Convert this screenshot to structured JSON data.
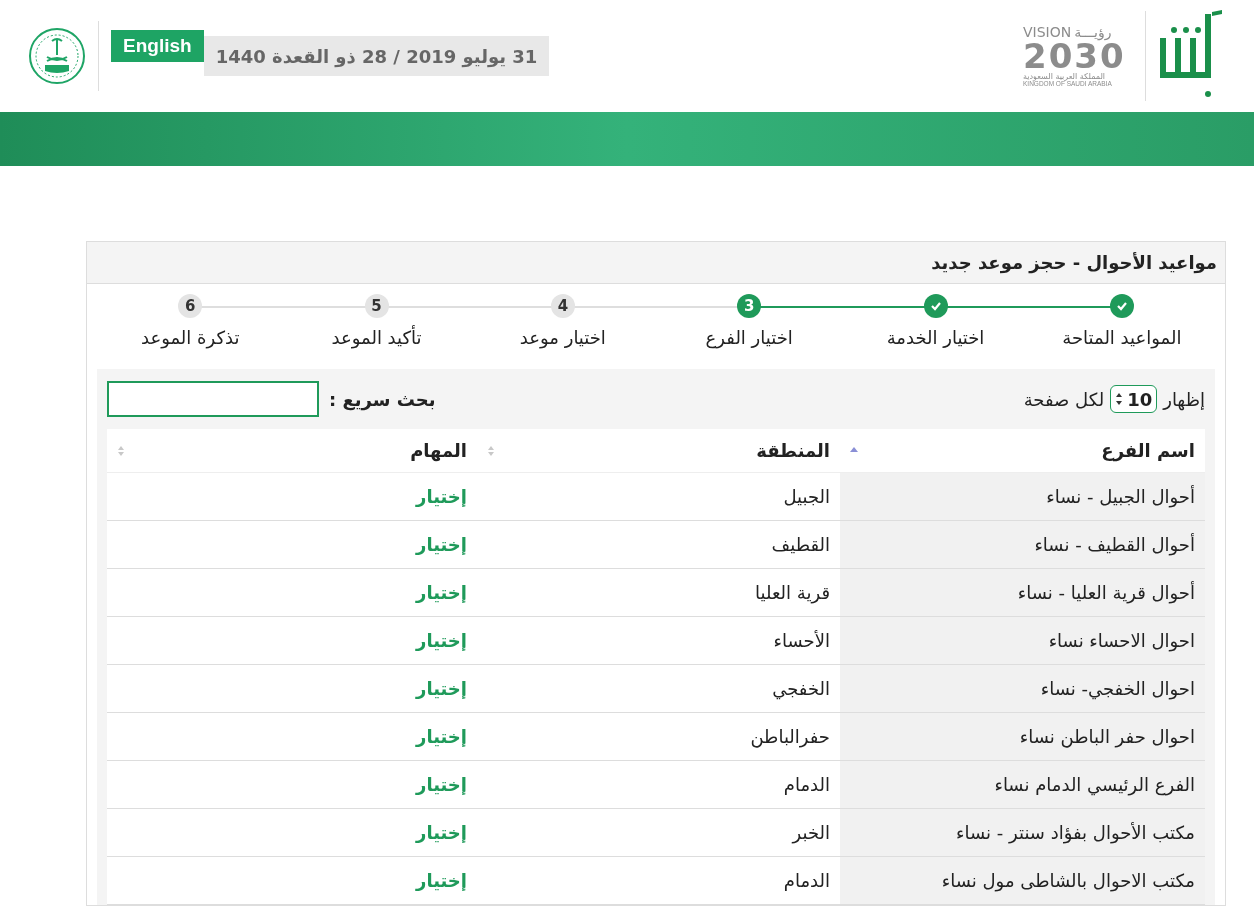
{
  "header": {
    "language_button": "English",
    "date": "31 يوليو 2019 / 28 ذو القعدة 1440",
    "vision_logo": {
      "line_en": "VISION",
      "line_ar": "رؤيـــة",
      "year": "2030",
      "country_ar": "المملكة العربية السعودية",
      "country_en": "KINGDOM OF SAUDI ARABIA"
    }
  },
  "panel": {
    "title": "مواعيد الأحوال - حجز موعد جديد",
    "steps": [
      {
        "label": "المواعيد المتاحة",
        "done": true,
        "current": false
      },
      {
        "label": "اختيار الخدمة",
        "done": true,
        "current": false
      },
      {
        "number": "3",
        "label": "اختيار الفرع",
        "done": false,
        "current": true
      },
      {
        "number": "4",
        "label": "اختيار موعد",
        "done": false,
        "current": false
      },
      {
        "number": "5",
        "label": "تأكيد الموعد",
        "done": false,
        "current": false
      },
      {
        "number": "6",
        "label": "تذكرة الموعد",
        "done": false,
        "current": false
      }
    ],
    "page_size": {
      "prefix": "إظهار",
      "value": "10",
      "suffix": "لكل صفحة"
    },
    "search": {
      "label": "بحث سريع :"
    },
    "table": {
      "columns": [
        {
          "label": "اسم الفرع",
          "sorted": true
        },
        {
          "label": "المنطقة",
          "sorted": false
        },
        {
          "label": "المهام",
          "sorted": false
        }
      ],
      "rows": [
        {
          "branch": "أحوال الجبيل - نساء",
          "region": "الجبيل",
          "action": "إختيار"
        },
        {
          "branch": "أحوال القطيف - نساء",
          "region": "القطيف",
          "action": "إختيار"
        },
        {
          "branch": "أحوال قرية العليا - نساء",
          "region": "قرية العليا",
          "action": "إختيار"
        },
        {
          "branch": "احوال الاحساء نساء",
          "region": "الأحساء",
          "action": "إختيار"
        },
        {
          "branch": "احوال الخفجي- نساء",
          "region": "الخفجي",
          "action": "إختيار"
        },
        {
          "branch": "احوال حفر الباطن نساء",
          "region": "حفرالباطن",
          "action": "إختيار"
        },
        {
          "branch": "الفرع الرئيسي الدمام نساء",
          "region": "الدمام",
          "action": "إختيار"
        },
        {
          "branch": "مكتب الأحوال بفؤاد سنتر - نساء",
          "region": "الخبر",
          "action": "إختيار"
        },
        {
          "branch": "مكتب الاحوال بالشاطى مول نساء",
          "region": "الدمام",
          "action": "إختيار"
        }
      ]
    }
  }
}
